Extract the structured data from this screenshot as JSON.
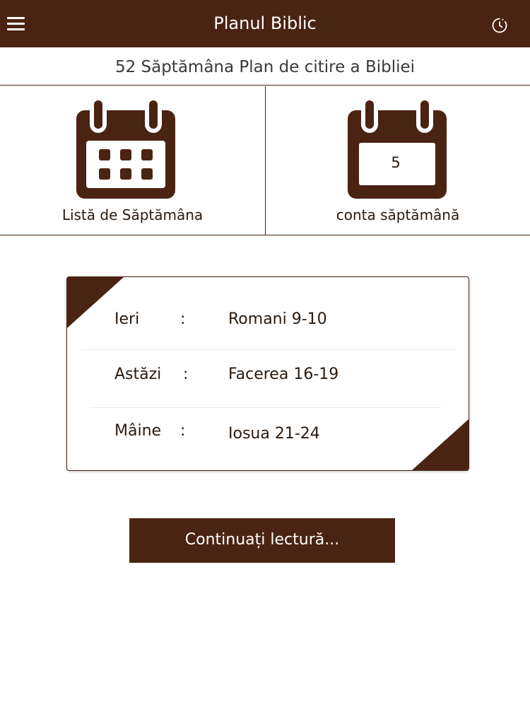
{
  "app": {
    "title": "Planul Biblic",
    "menu_icon": "hamburger-menu-icon",
    "timer_icon": "timer-icon",
    "brand_color": "#4a2412"
  },
  "plan": {
    "subtitle": "52 Săptămâna Plan de citire a Bibliei"
  },
  "tiles": {
    "week_list": {
      "label": "Listă de Săptămâna",
      "icon": "calendar-grid-icon"
    },
    "week_count": {
      "label": "conta săptămână",
      "icon": "calendar-number-icon",
      "value": "5"
    }
  },
  "readings": [
    {
      "day": "Ieri",
      "separator": ":",
      "passage": "Romani  9-10"
    },
    {
      "day": "Astăzi",
      "separator": ":",
      "passage": "Facerea  16-19"
    },
    {
      "day": "Mâine",
      "separator": ":",
      "passage": "Iosua  21-24"
    }
  ],
  "actions": {
    "continue_label": "Continuați lectură..."
  }
}
